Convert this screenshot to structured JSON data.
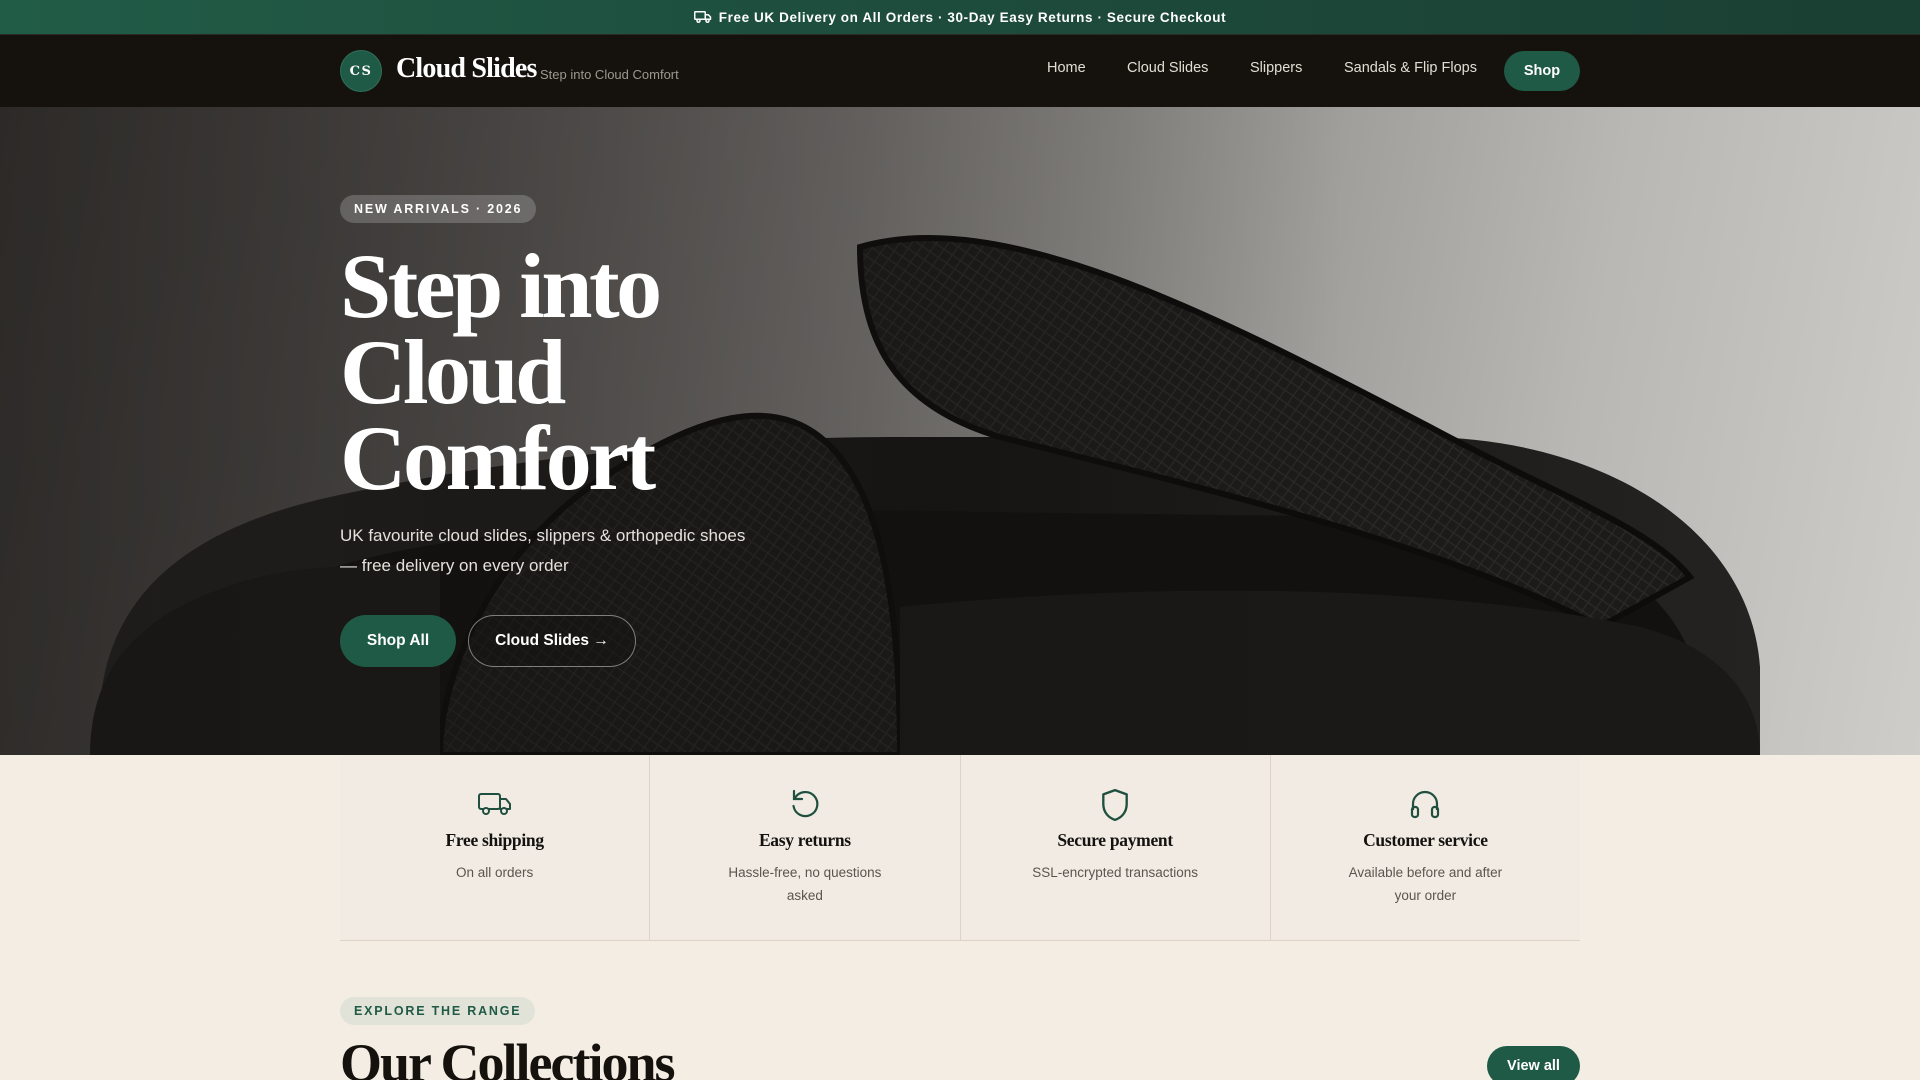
{
  "announcement": {
    "icon": "truck-icon",
    "text": "Free UK Delivery on All Orders · 30-Day Easy Returns · Secure Checkout"
  },
  "header": {
    "logo_initials": "CS",
    "brand_name": "Cloud Slides",
    "tagline": "Step into Cloud Comfort",
    "nav": [
      "Home",
      "Cloud Slides",
      "Slippers",
      "Sandals & Flip Flops"
    ],
    "shop_label": "Shop"
  },
  "hero": {
    "badge": "NEW ARRIVALS · 2026",
    "title_line1": "Step into",
    "title_line2": "Cloud",
    "title_line3": "Comfort",
    "subtitle": "UK favourite cloud slides, slippers & orthopedic shoes — free delivery on every order",
    "primary_cta": "Shop All",
    "secondary_cta": "Cloud Slides →"
  },
  "features": [
    {
      "icon": "truck-icon",
      "title": "Free shipping",
      "desc": "On all orders"
    },
    {
      "icon": "refresh-icon",
      "title": "Easy returns",
      "desc": "Hassle-free, no questions asked"
    },
    {
      "icon": "shield-icon",
      "title": "Secure payment",
      "desc": "SSL-encrypted transactions"
    },
    {
      "icon": "headphones-icon",
      "title": "Customer service",
      "desc": "Available before and after your order"
    }
  ],
  "collections": {
    "eyebrow": "EXPLORE THE RANGE",
    "title": "Our Collections",
    "view_all": "View all"
  },
  "colors": {
    "brand_green": "#1f5a46",
    "header_dark": "#15120d",
    "cream": "#f4ede4"
  }
}
